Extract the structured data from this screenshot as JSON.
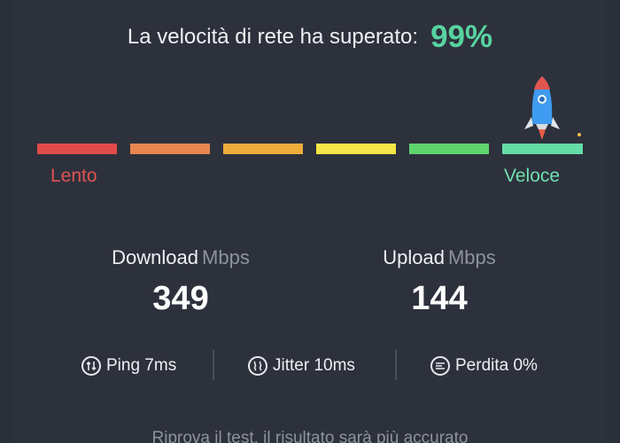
{
  "headline": {
    "text": "La velocità di rete ha superato:",
    "percent": "99%"
  },
  "speed_scale": {
    "label_slow": "Lento",
    "label_fast": "Veloce",
    "segment_colors": [
      "#e14b4b",
      "#e9854f",
      "#eeac3c",
      "#f3e646",
      "#5fd46e",
      "#63dca6"
    ],
    "indicator_icon": "rocket-icon"
  },
  "download": {
    "label": "Download",
    "unit": "Mbps",
    "value": "349"
  },
  "upload": {
    "label": "Upload",
    "unit": "Mbps",
    "value": "144"
  },
  "stats": {
    "ping": {
      "icon": "ping-icon",
      "text": "Ping 7ms"
    },
    "jitter": {
      "icon": "jitter-icon",
      "text": "Jitter 10ms"
    },
    "loss": {
      "icon": "packet-loss-icon",
      "text": "Perdita 0%"
    }
  },
  "retry_text": "Riprova il test, il risultato sarà più accurato",
  "colors": {
    "background": "#2d313c",
    "accent": "#57d3a0",
    "slow": "#e05252",
    "fast": "#6fe0ad"
  }
}
